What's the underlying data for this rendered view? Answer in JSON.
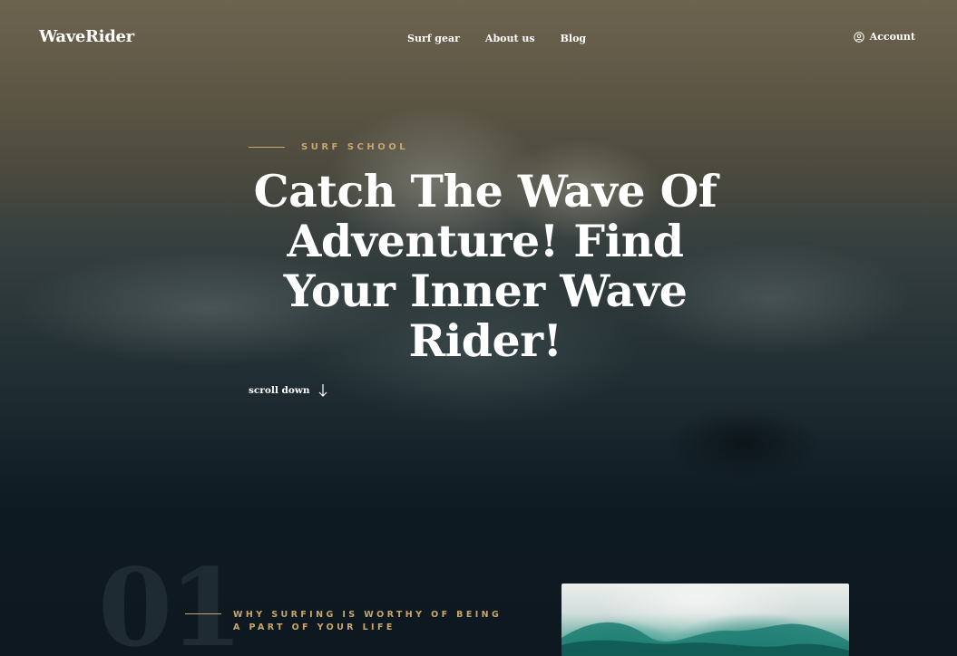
{
  "header": {
    "logo": "WaveRider",
    "nav": [
      {
        "label": "Surf gear"
      },
      {
        "label": "About us"
      },
      {
        "label": "Blog"
      }
    ],
    "account_label": "Account",
    "account_icon": "user-circle-icon"
  },
  "hero": {
    "eyebrow": "SURF SCHOOL",
    "headline": "Catch The Wave Of Adventure! Find Your Inner Wave Rider!",
    "scroll_label": "scroll down",
    "scroll_icon": "arrow-down-icon"
  },
  "section": {
    "number": "01",
    "title": "WHY SURFING IS WORTHY OF BEING A PART OF YOUR LIFE"
  },
  "colors": {
    "accent": "#c9a76a",
    "text": "#ffffff",
    "dark_bg": "#0d1820"
  }
}
